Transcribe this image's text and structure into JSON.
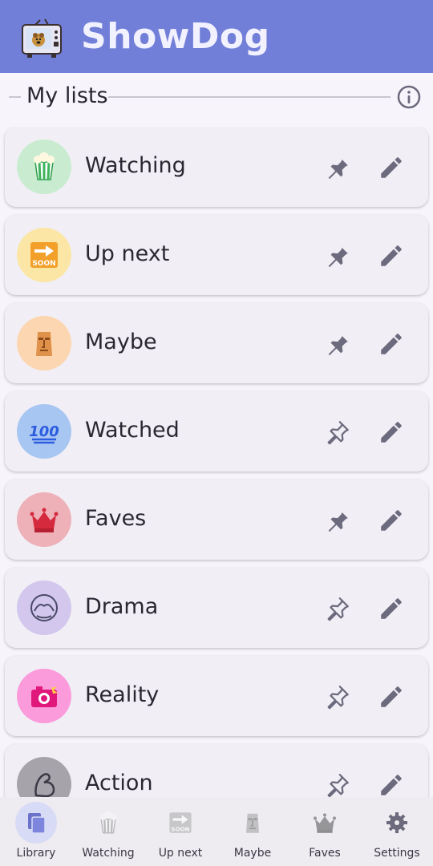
{
  "app": {
    "title": "ShowDog"
  },
  "section": {
    "title": "My lists"
  },
  "lists": [
    {
      "label": "Watching",
      "icon": "popcorn-icon",
      "bg": "#c9ecd0",
      "pinned": true
    },
    {
      "label": "Up next",
      "icon": "soon-arrow-icon",
      "bg": "#fbe6a6",
      "pinned": true
    },
    {
      "label": "Maybe",
      "icon": "moai-icon",
      "bg": "#fcd6b0",
      "pinned": true
    },
    {
      "label": "Watched",
      "icon": "hundred-points-icon",
      "bg": "#a8c6f2",
      "pinned": false
    },
    {
      "label": "Faves",
      "icon": "crown-icon",
      "bg": "#eeb1b8",
      "pinned": true
    },
    {
      "label": "Drama",
      "icon": "shush-face-icon",
      "bg": "#d3c7ee",
      "pinned": false
    },
    {
      "label": "Reality",
      "icon": "camera-flash-icon",
      "bg": "#fb9bdc",
      "pinned": false
    },
    {
      "label": "Action",
      "icon": "flexed-arm-icon",
      "bg": "#a7a3ab",
      "pinned": false
    }
  ],
  "nav": [
    {
      "label": "Library",
      "icon": "library-icon",
      "active": true
    },
    {
      "label": "Watching",
      "icon": "popcorn-icon",
      "active": false
    },
    {
      "label": "Up next",
      "icon": "soon-arrow-icon",
      "active": false
    },
    {
      "label": "Maybe",
      "icon": "moai-icon",
      "active": false
    },
    {
      "label": "Faves",
      "icon": "crown-icon",
      "active": false
    },
    {
      "label": "Settings",
      "icon": "gear-icon",
      "active": false
    }
  ],
  "colors": {
    "brand": "#717fd8",
    "background": "#f7f5fb",
    "card": "#f1eff5",
    "icon": "#6c6a7d",
    "navActive": "#d7dbf5"
  }
}
